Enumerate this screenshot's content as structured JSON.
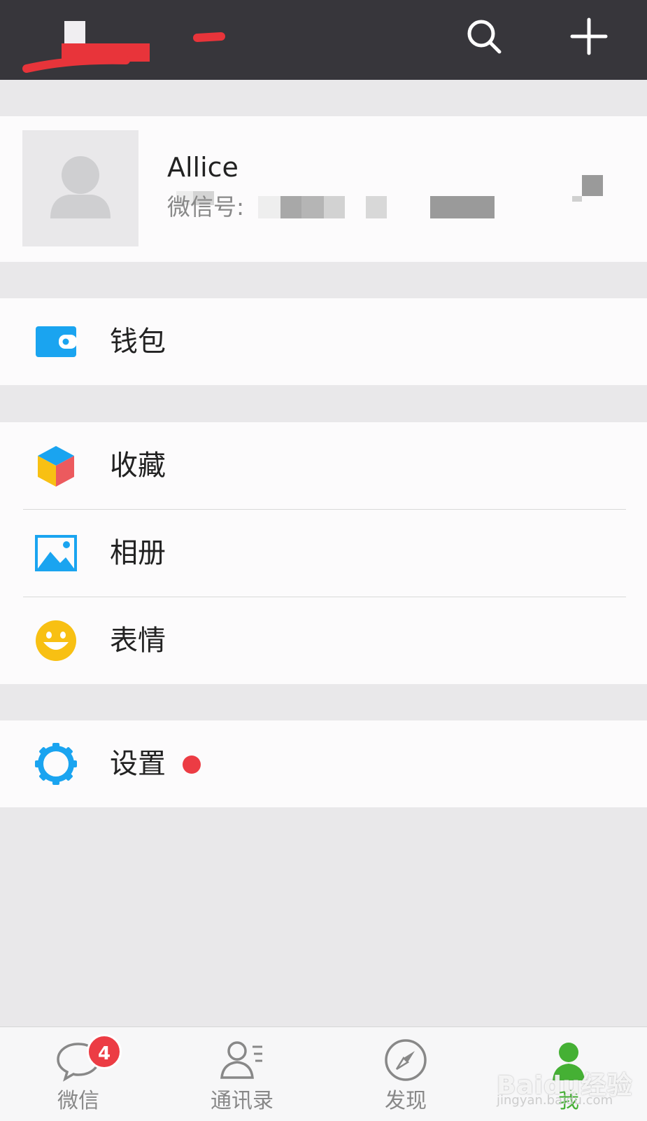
{
  "profile": {
    "name": "Allice",
    "wechat_id_label": "微信号:"
  },
  "menu": {
    "wallet": "钱包",
    "favorites": "收藏",
    "album": "相册",
    "stickers": "表情",
    "settings": "设置"
  },
  "tabs": [
    {
      "label": "微信",
      "icon": "chat-bubble-icon",
      "badge": "4"
    },
    {
      "label": "通讯录",
      "icon": "contacts-icon"
    },
    {
      "label": "发现",
      "icon": "compass-icon"
    },
    {
      "label": "我",
      "icon": "person-icon",
      "active": true
    }
  ],
  "watermark": {
    "text": "Baidu经验",
    "sub": "jingyan.baidu.com"
  },
  "colors": {
    "topbar": "#37363b",
    "accent_green": "#45b034",
    "badge_red": "#ec3c44",
    "icon_blue": "#1aa4f0",
    "icon_yellow": "#f8c013"
  },
  "icons": {
    "topbar": [
      "search-icon",
      "plus-icon"
    ],
    "menu": [
      "wallet-icon",
      "cube-icon",
      "picture-icon",
      "smiley-icon",
      "gear-icon"
    ]
  }
}
